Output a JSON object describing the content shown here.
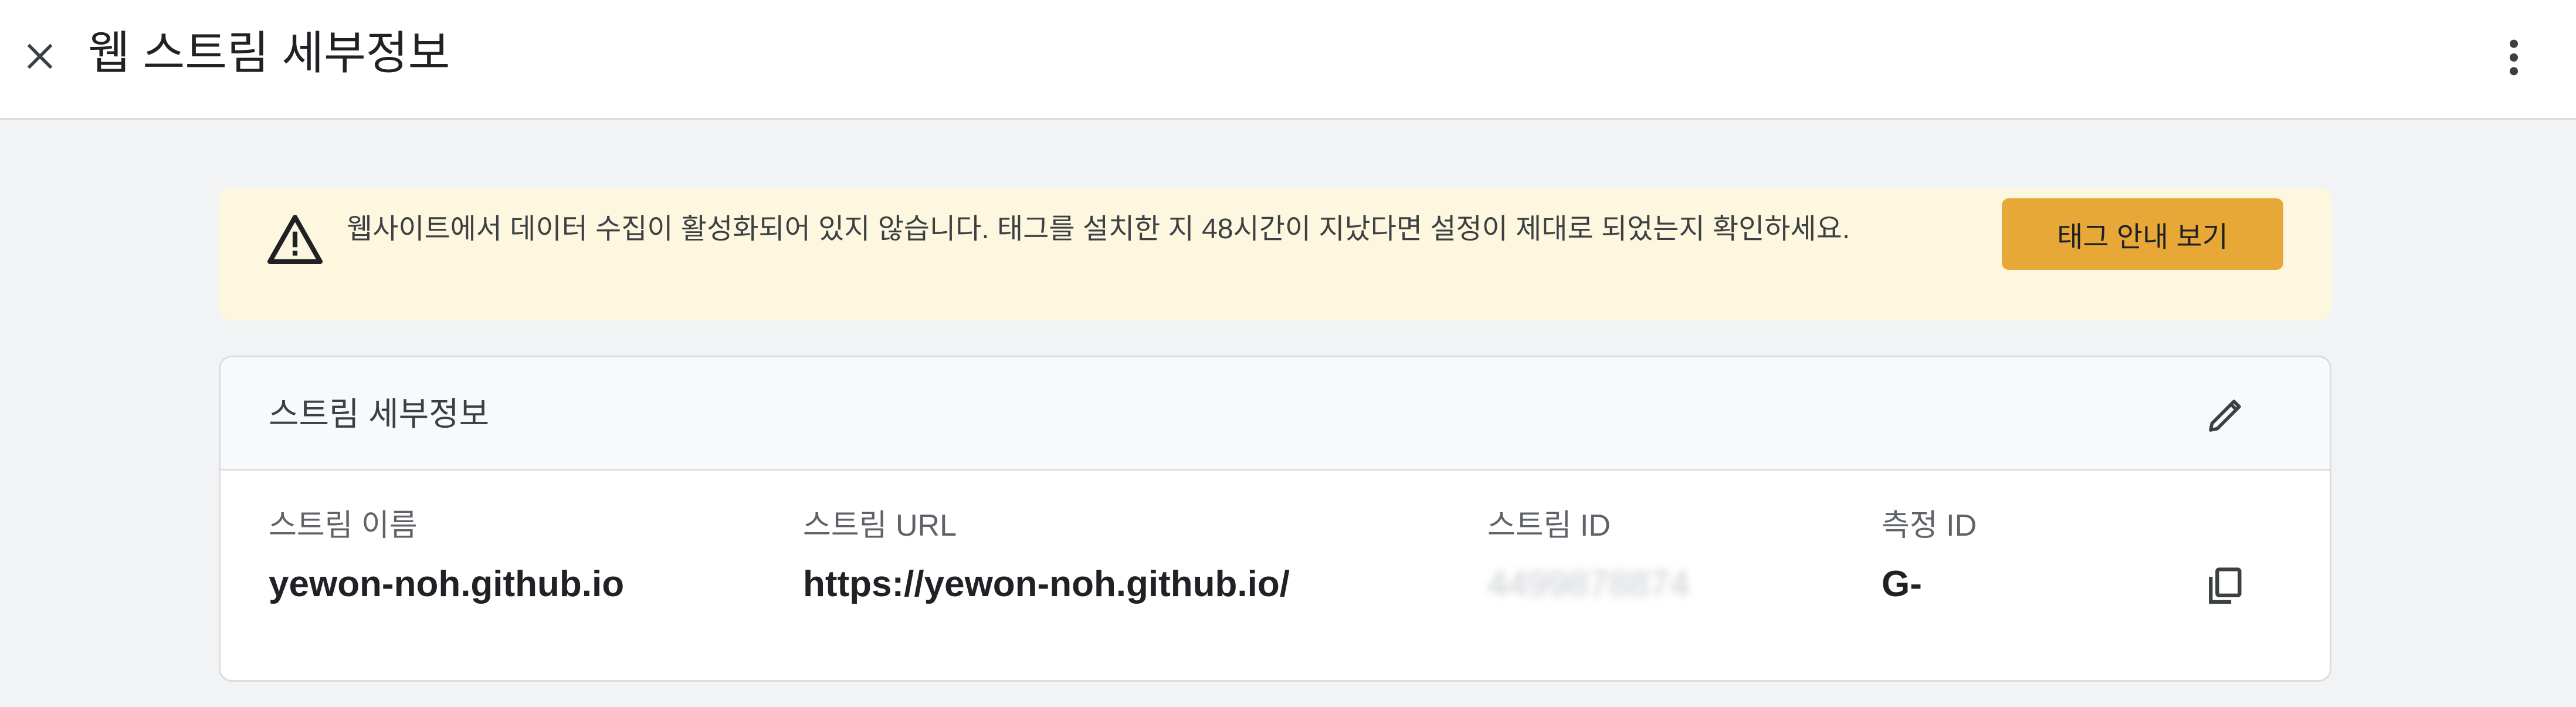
{
  "header": {
    "title": "웹 스트림 세부정보",
    "close_icon": "close-icon",
    "more_icon": "more-vert-icon"
  },
  "banner": {
    "message": "웹사이트에서 데이터 수집이 활성화되어 있지 않습니다. 태그를 설치한 지 48시간이 지났다면 설정이 제대로 되었는지 확인하세요.",
    "button_label": "태그 안내 보기",
    "icon": "warning-icon",
    "background": "#fef7e0",
    "button_color": "#e8a838"
  },
  "card": {
    "title": "스트림 세부정보",
    "edit_icon": "pencil-icon",
    "copy_icon": "copy-icon",
    "fields": [
      {
        "label": "스트림 이름",
        "value": "yewon-noh.github.io"
      },
      {
        "label": "스트림 URL",
        "value": "https://yewon-noh.github.io/"
      },
      {
        "label": "스트림 ID",
        "value": "4499878874"
      },
      {
        "label": "측정 ID",
        "value": "G-"
      }
    ]
  }
}
